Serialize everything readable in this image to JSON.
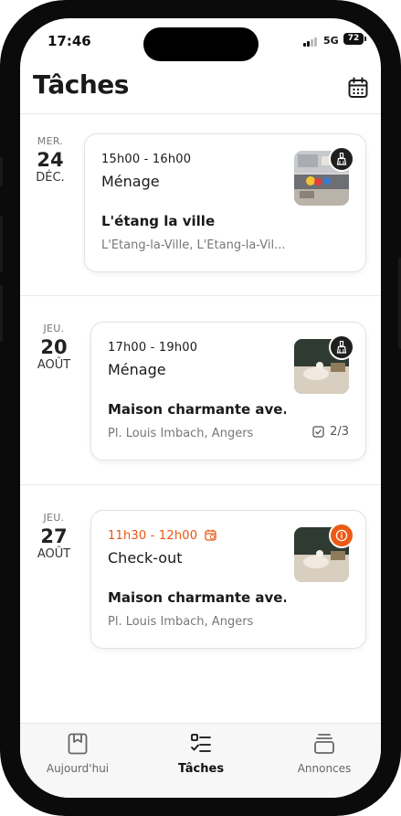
{
  "status_bar": {
    "time": "17:46",
    "network": "5G",
    "battery": "72"
  },
  "header": {
    "title": "Tâches",
    "calendar_icon": "calendar-icon"
  },
  "tasks": [
    {
      "date": {
        "weekday": "MER.",
        "day": "24",
        "month": "DÉC."
      },
      "hours": "15h00 - 16h00",
      "type": "Ménage",
      "property": "L'étang la ville",
      "address": "L'Étang-la-Ville, L'Étang-la-Vil...",
      "badge_icon": "cleaning-icon"
    },
    {
      "date": {
        "weekday": "JEU.",
        "day": "20",
        "month": "AOÛT"
      },
      "hours": "17h00 - 19h00",
      "type": "Ménage",
      "property": "Maison charmante ave...",
      "address": "Pl. Louis Imbach, Angers",
      "badge_icon": "cleaning-icon",
      "progress": "2/3"
    },
    {
      "date": {
        "weekday": "JEU.",
        "day": "27",
        "month": "AOÛT"
      },
      "hours": "11h30 - 12h00",
      "type": "Check-out",
      "property": "Maison charmante ave...",
      "address": "Pl. Louis Imbach, Angers",
      "badge_icon": "info-icon",
      "time_icon": "alarm-clock-icon"
    }
  ],
  "tabbar": {
    "items": [
      {
        "label": "Aujourd'hui",
        "icon": "bookmark-icon"
      },
      {
        "label": "Tâches",
        "icon": "checklist-icon"
      },
      {
        "label": "Annonces",
        "icon": "stack-icon"
      }
    ]
  },
  "colors": {
    "accent": "#ec5a14",
    "text": "#1a1a1a",
    "muted": "#777777"
  }
}
